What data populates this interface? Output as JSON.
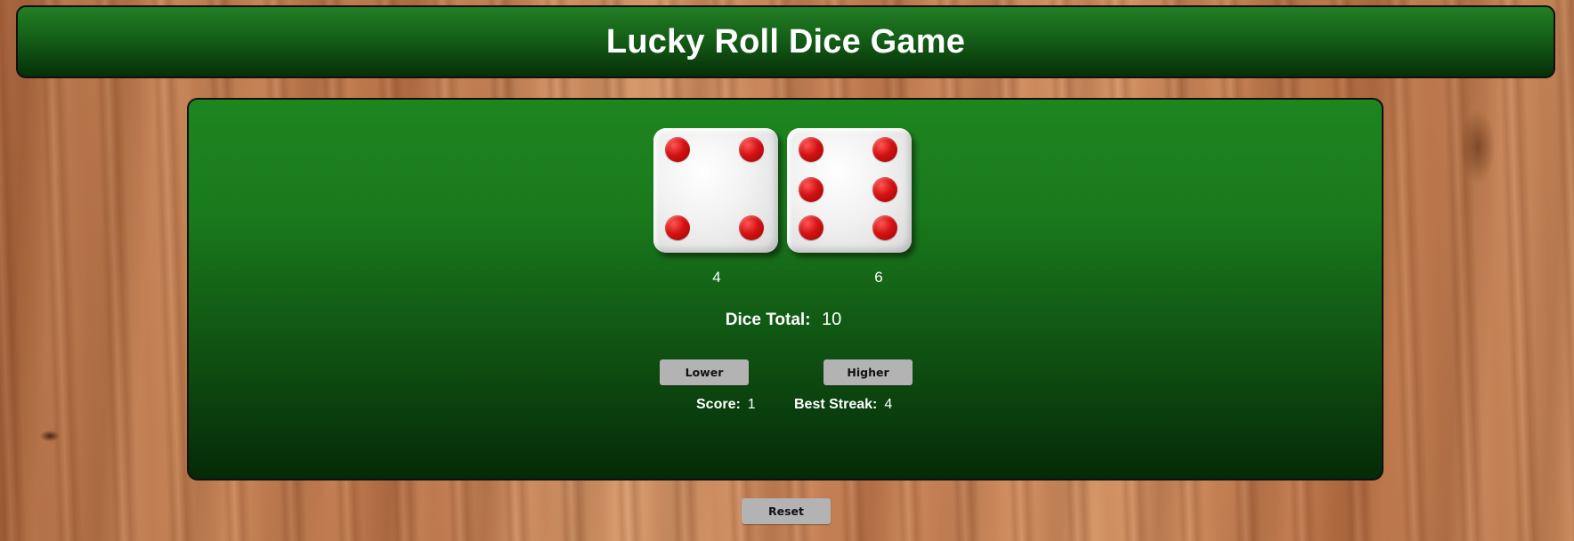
{
  "header": {
    "title": "Lucky Roll Dice Game"
  },
  "dice": [
    {
      "value": 4,
      "value_label": "4"
    },
    {
      "value": 6,
      "value_label": "6"
    }
  ],
  "total": {
    "label": "Dice Total:",
    "value": "10"
  },
  "controls": {
    "lower_label": "Lower",
    "higher_label": "Higher",
    "reset_label": "Reset"
  },
  "stats": {
    "score_label": "Score:",
    "score_value": "1",
    "best_streak_label": "Best Streak:",
    "best_streak_value": "4"
  },
  "colors": {
    "table_green": "#1e851f",
    "pip_red": "#d31212",
    "button_gray": "#b3b3b3"
  }
}
